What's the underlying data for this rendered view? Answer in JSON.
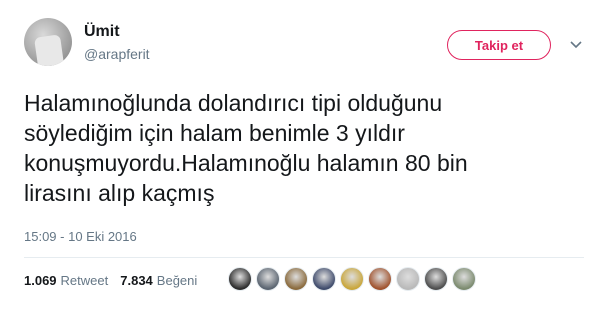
{
  "user": {
    "display_name": "Ümit",
    "handle": "@arapferit",
    "avatar_icon": "profile-photo"
  },
  "follow_button": {
    "label": "Takip et",
    "color": "#e0245e"
  },
  "menu_caret_icon": "chevron-down-icon",
  "tweet": {
    "lines": [
      "Halamınoğlunda dolandırıcı tipi olduğunu",
      "söylediğim için halam benimle 3 yıldır",
      "konuşmuyordu.Halamınoğlu halamın 80 bin",
      "lirasını alıp kaçmış"
    ],
    "timestamp": "15:09 - 10 Eki 2016"
  },
  "stats": {
    "retweets_count": "1.069",
    "retweets_label": "Retweet",
    "likes_count": "7.834",
    "likes_label": "Beğeni"
  },
  "liker_avatars": [
    {
      "name": "liker-avatar-1",
      "color": "#2b2b2b"
    },
    {
      "name": "liker-avatar-2",
      "color": "#5a6470"
    },
    {
      "name": "liker-avatar-3",
      "color": "#8a6a3c"
    },
    {
      "name": "liker-avatar-4",
      "color": "#3e4a6b"
    },
    {
      "name": "liker-avatar-5",
      "color": "#c9a63a"
    },
    {
      "name": "liker-avatar-6",
      "color": "#a0522d"
    },
    {
      "name": "liker-avatar-7",
      "color": "#b9b9b9"
    },
    {
      "name": "liker-avatar-8",
      "color": "#4d4d4d"
    },
    {
      "name": "liker-avatar-9",
      "color": "#7b8a6e"
    }
  ]
}
